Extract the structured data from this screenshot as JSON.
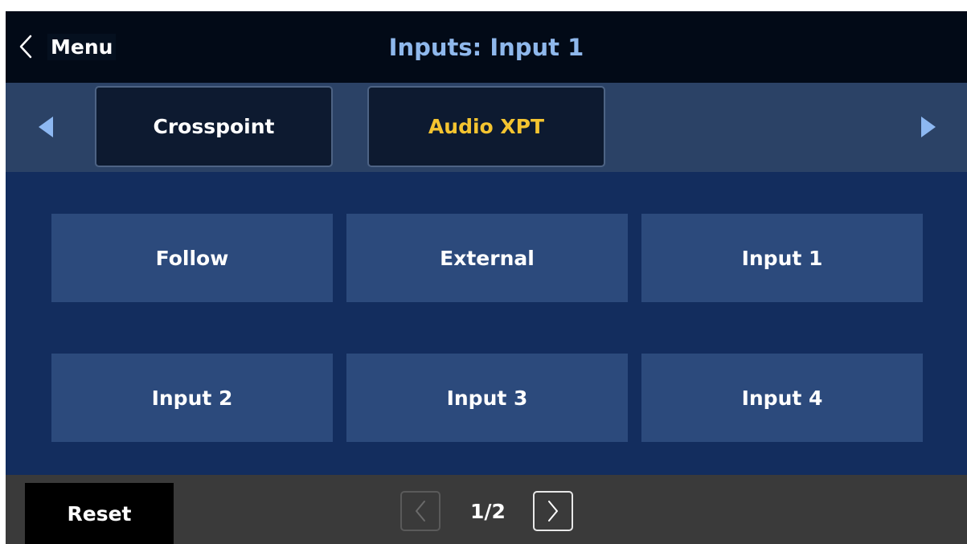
{
  "header": {
    "back_label": "Menu",
    "title": "Inputs: Input 1"
  },
  "tabs": [
    {
      "label": "Crosspoint",
      "selected": false
    },
    {
      "label": "Audio XPT",
      "selected": true
    }
  ],
  "options": [
    {
      "label": "Follow"
    },
    {
      "label": "External"
    },
    {
      "label": "Input 1"
    },
    {
      "label": "Input 2"
    },
    {
      "label": "Input 3"
    },
    {
      "label": "Input 4"
    }
  ],
  "footer": {
    "reset_label": "Reset",
    "page_indicator": "1/2"
  },
  "icons": {
    "back": "chevron-left-icon",
    "tab_prev": "triangle-left-icon",
    "tab_next": "triangle-right-icon",
    "page_prev": "chevron-left-icon",
    "page_next": "chevron-right-icon"
  },
  "colors": {
    "header_bg": "#020a17",
    "title": "#8fb8ec",
    "tabbar_bg": "#2b4266",
    "tab_bg": "#0d1a30",
    "tab_selected_text": "#f4c430",
    "grid_bg": "#132d5e",
    "cell_bg": "#2c4a7c",
    "arrow": "#8db8f2",
    "footer_bg": "#3a3a3a"
  }
}
